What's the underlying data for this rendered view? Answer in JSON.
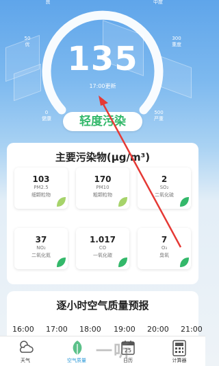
{
  "aqi": {
    "value": "135",
    "update_time": "17:00更新",
    "level": "轻度污染",
    "level_color": "#33b86a",
    "scale": [
      {
        "label": "0\n健康"
      },
      {
        "label": "50\n优"
      },
      {
        "label": "良"
      },
      {
        "label": "中度"
      },
      {
        "label": "300\n重度"
      },
      {
        "label": "500\n严重"
      }
    ]
  },
  "pollutants": {
    "title": "主要污染物(μg/m³)",
    "items": [
      {
        "value": "103",
        "code": "PM2.5",
        "name": "细颗粒物",
        "leaf": "leaf-icon",
        "leaf_color": "#a6d36a"
      },
      {
        "value": "170",
        "code": "PM10",
        "name": "粗颗粒物",
        "leaf": "leaf-icon",
        "leaf_color": "#a6d36a"
      },
      {
        "value": "2",
        "code": "SO₂",
        "name": "二氧化硫",
        "leaf": "leaf-icon",
        "leaf_color": "#33b86a"
      },
      {
        "value": "37",
        "code": "NO₂",
        "name": "二氧化氮",
        "leaf": "leaf-icon",
        "leaf_color": "#33b86a"
      },
      {
        "value": "1.017",
        "code": "CO",
        "name": "一氧化碳",
        "leaf": "leaf-icon",
        "leaf_color": "#33b86a"
      },
      {
        "value": "7",
        "code": "O₃",
        "name": "臭氧",
        "leaf": "leaf-icon",
        "leaf_color": "#33b86a"
      }
    ]
  },
  "forecast": {
    "title": "逐小时空气质量预报",
    "hours": [
      "16:00",
      "17:00",
      "18:00",
      "19:00",
      "20:00",
      "21:00"
    ]
  },
  "tabs": [
    {
      "label": "天气",
      "icon": "weather-icon",
      "active": false
    },
    {
      "label": "空气质量",
      "icon": "leaf-icon",
      "active": true
    },
    {
      "label": "日历",
      "icon": "calendar-icon",
      "active": false
    },
    {
      "label": "计算器",
      "icon": "calculator-icon",
      "active": false
    }
  ],
  "calendar_day": "25",
  "watermark": "一听"
}
